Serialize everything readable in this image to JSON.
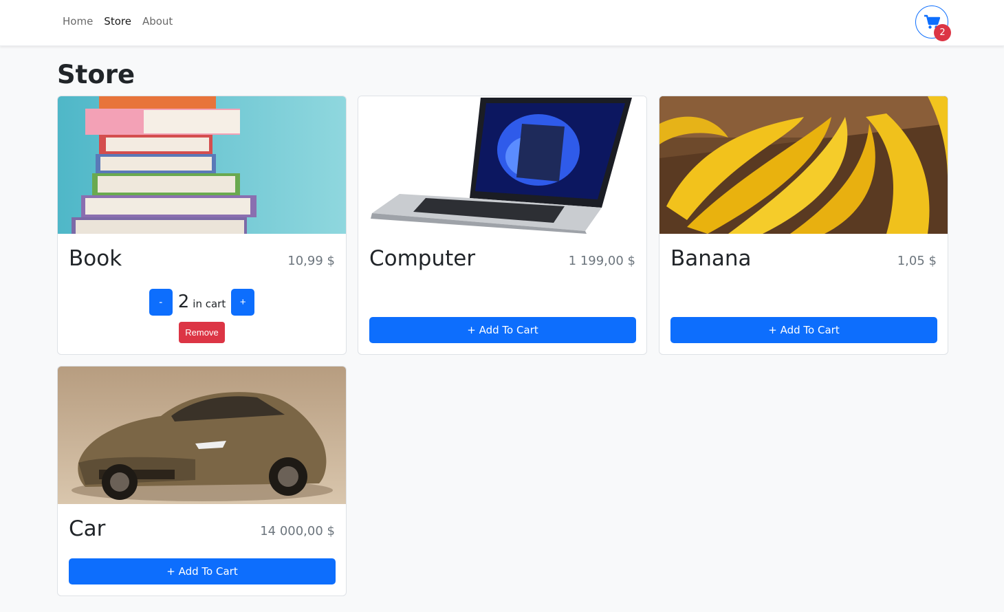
{
  "nav": {
    "links": [
      "Home",
      "Store",
      "About"
    ],
    "active": "Store",
    "cart_count": "2"
  },
  "page": {
    "title": "Store"
  },
  "products": [
    {
      "name": "Book",
      "price": "10,99 $",
      "quantity": "2",
      "in_cart_label": "in cart",
      "minus_label": "-",
      "plus_label": "+",
      "remove_label": "Remove"
    },
    {
      "name": "Computer",
      "price": "1 199,00 $",
      "button_label": "+ Add To Cart"
    },
    {
      "name": "Banana",
      "price": "1,05 $",
      "button_label": "+ Add To Cart"
    },
    {
      "name": "Car",
      "price": "14 000,00 $",
      "button_label": "+ Add To Cart"
    }
  ],
  "colors": {
    "primary": "#0d6efd",
    "danger": "#dc3545",
    "background": "#f8f9fa"
  }
}
